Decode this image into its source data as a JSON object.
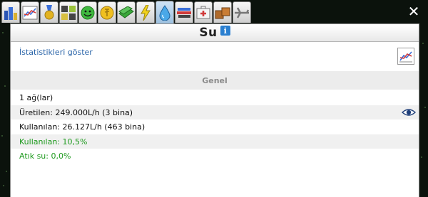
{
  "window": {
    "title": "Su",
    "info_glyph": "i",
    "close_glyph": "✕",
    "stats_link": "İstatistikleri göster"
  },
  "tabs": [
    {
      "icon": "city-overview-icon"
    },
    {
      "icon": "statistics-chart-icon"
    },
    {
      "icon": "award-medal-icon"
    },
    {
      "icon": "zones-grid-icon"
    },
    {
      "icon": "happiness-smiley-icon"
    },
    {
      "icon": "coin-icon"
    },
    {
      "icon": "money-bills-icon"
    },
    {
      "icon": "electricity-bolt-icon"
    },
    {
      "icon": "water-drop-icon",
      "active": true
    },
    {
      "icon": "education-books-icon"
    },
    {
      "icon": "health-firstaid-icon"
    },
    {
      "icon": "cargo-boxes-icon"
    },
    {
      "icon": "airplane-icon"
    }
  ],
  "section": {
    "label": "Genel"
  },
  "rows": {
    "networks": "1 ağ(lar)",
    "produced": "Üretilen: 249.000L/h (3 bina)",
    "consumed": "Kullanılan: 26.127L/h (463 bina)",
    "usage": "Kullanılan: 10,5%",
    "waste": "Atık su: 0,0%"
  },
  "colors": {
    "accent_link": "#2a64a8",
    "positive_green": "#1e9a1e",
    "section_header_text": "#8c8c8c"
  }
}
